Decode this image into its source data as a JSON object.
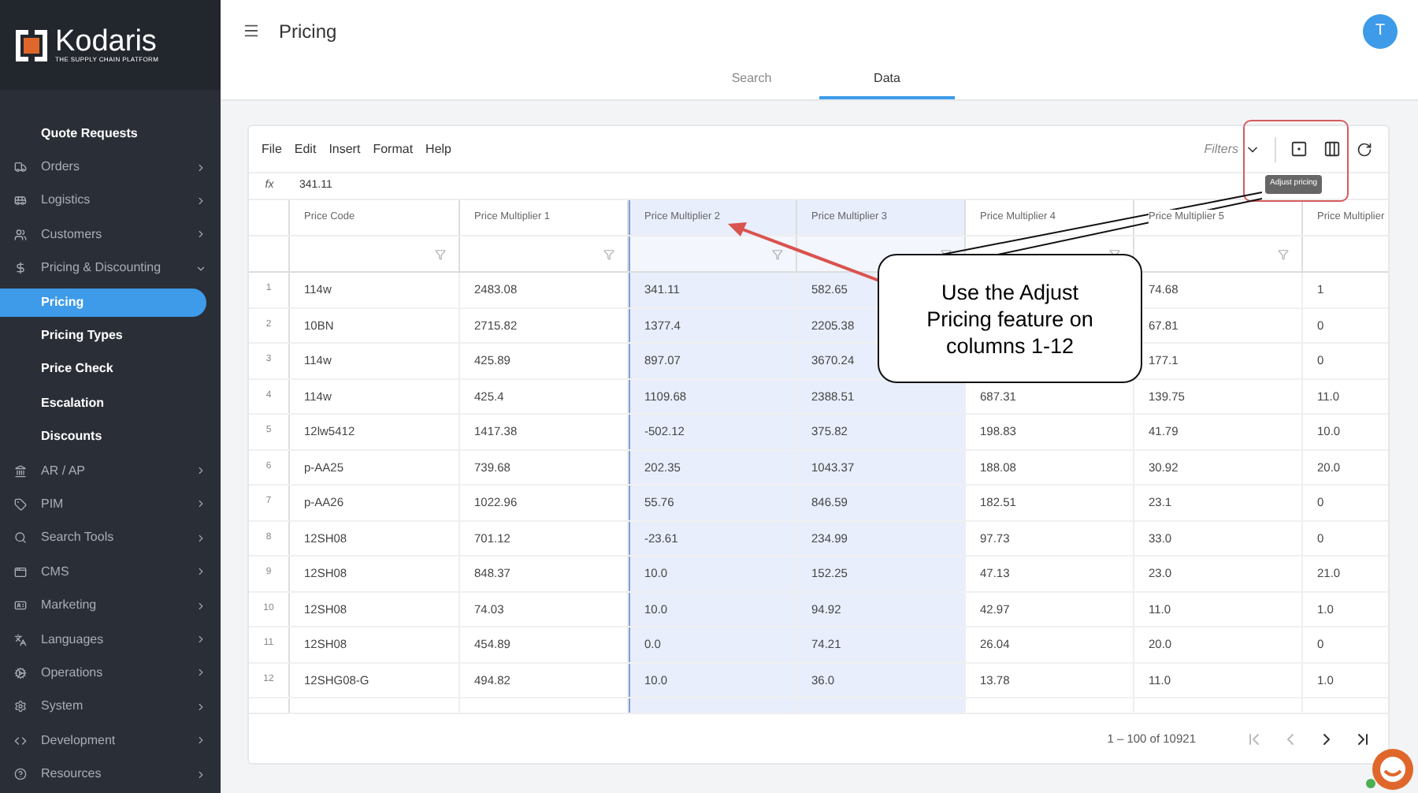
{
  "sidebar": {
    "logo": {
      "name": "Kodaris",
      "tagline": "THE SUPPLY CHAIN PLATFORM"
    },
    "items": [
      {
        "label": "Quote Requests",
        "kind": "child"
      },
      {
        "label": "Orders",
        "kind": "section",
        "expanded": false
      },
      {
        "label": "Logistics",
        "kind": "section",
        "expanded": false
      },
      {
        "label": "Customers",
        "kind": "section",
        "expanded": false
      },
      {
        "label": "Pricing & Discounting",
        "kind": "section",
        "expanded": true,
        "children": [
          {
            "label": "Pricing",
            "selected": true
          },
          {
            "label": "Pricing Types",
            "selected": false
          },
          {
            "label": "Price Check",
            "selected": false
          },
          {
            "label": "Escalation",
            "selected": false
          },
          {
            "label": "Discounts",
            "selected": false
          }
        ]
      },
      {
        "label": "AR / AP",
        "kind": "section",
        "expanded": false
      },
      {
        "label": "PIM",
        "kind": "section",
        "expanded": false
      },
      {
        "label": "Search Tools",
        "kind": "section",
        "expanded": false
      },
      {
        "label": "CMS",
        "kind": "section",
        "expanded": false
      },
      {
        "label": "Marketing",
        "kind": "section",
        "expanded": false
      },
      {
        "label": "Languages",
        "kind": "section",
        "expanded": false
      },
      {
        "label": "Operations",
        "kind": "section",
        "expanded": false
      },
      {
        "label": "System",
        "kind": "section",
        "expanded": false
      },
      {
        "label": "Development",
        "kind": "section",
        "expanded": false
      },
      {
        "label": "Resources",
        "kind": "section",
        "expanded": false
      }
    ]
  },
  "header": {
    "title": "Pricing",
    "avatar": "T"
  },
  "tabs": [
    {
      "label": "Search",
      "selected": false
    },
    {
      "label": "Data",
      "selected": true
    }
  ],
  "sheet": {
    "menu": [
      "File",
      "Edit",
      "Insert",
      "Format",
      "Help"
    ],
    "filters": "Filters",
    "tooltip": "Adjust pricing",
    "formula": {
      "label": "fx",
      "value": "341.11"
    },
    "columns": [
      {
        "label": "Price Code",
        "selected": false
      },
      {
        "label": "Price Multiplier 1",
        "selected": false
      },
      {
        "label": "Price Multiplier 2",
        "selected": true
      },
      {
        "label": "Price Multiplier 3",
        "selected": true
      },
      {
        "label": "Price Multiplier 4",
        "selected": false
      },
      {
        "label": "Price Multiplier 5",
        "selected": false
      },
      {
        "label": "Price Multiplier",
        "selected": false
      }
    ],
    "rows": [
      {
        "n": "1",
        "cells": [
          "114w",
          "2483.08",
          "341.11",
          "582.65",
          null,
          "74.68",
          "1"
        ]
      },
      {
        "n": "2",
        "cells": [
          "10BN",
          "2715.82",
          "1377.4",
          "2205.38",
          null,
          "67.81",
          "0"
        ]
      },
      {
        "n": "3",
        "cells": [
          "114w",
          "425.89",
          "897.07",
          "3670.24",
          null,
          "177.1",
          "0"
        ]
      },
      {
        "n": "4",
        "cells": [
          "114w",
          "425.4",
          "1109.68",
          "2388.51",
          "687.31",
          "139.75",
          "11.0"
        ]
      },
      {
        "n": "5",
        "cells": [
          "12lw5412",
          "1417.38",
          "-502.12",
          "375.82",
          "198.83",
          "41.79",
          "10.0"
        ]
      },
      {
        "n": "6",
        "cells": [
          "p-AA25",
          "739.68",
          "202.35",
          "1043.37",
          "188.08",
          "30.92",
          "20.0"
        ]
      },
      {
        "n": "7",
        "cells": [
          "p-AA26",
          "1022.96",
          "55.76",
          "846.59",
          "182.51",
          "23.1",
          "0"
        ]
      },
      {
        "n": "8",
        "cells": [
          "12SH08",
          "701.12",
          "-23.61",
          "234.99",
          "97.73",
          "33.0",
          "0"
        ]
      },
      {
        "n": "9",
        "cells": [
          "12SH08",
          "848.37",
          "10.0",
          "152.25",
          "47.13",
          "23.0",
          "21.0"
        ]
      },
      {
        "n": "10",
        "cells": [
          "12SH08",
          "74.03",
          "10.0",
          "94.92",
          "42.97",
          "11.0",
          "1.0"
        ]
      },
      {
        "n": "11",
        "cells": [
          "12SH08",
          "454.89",
          "0.0",
          "74.21",
          "26.04",
          "20.0",
          "0"
        ]
      },
      {
        "n": "12",
        "cells": [
          "12SHG08-G",
          "494.82",
          "10.0",
          "36.0",
          "13.78",
          "11.0",
          "1.0"
        ]
      }
    ],
    "pager": {
      "range": "1 – 100 of 10921",
      "buttons": [
        {
          "disabled": true
        },
        {
          "disabled": true
        },
        {
          "disabled": false
        },
        {
          "disabled": false
        }
      ]
    }
  },
  "annotation": {
    "text": "Use the Adjust Pricing feature on columns 1-12"
  }
}
